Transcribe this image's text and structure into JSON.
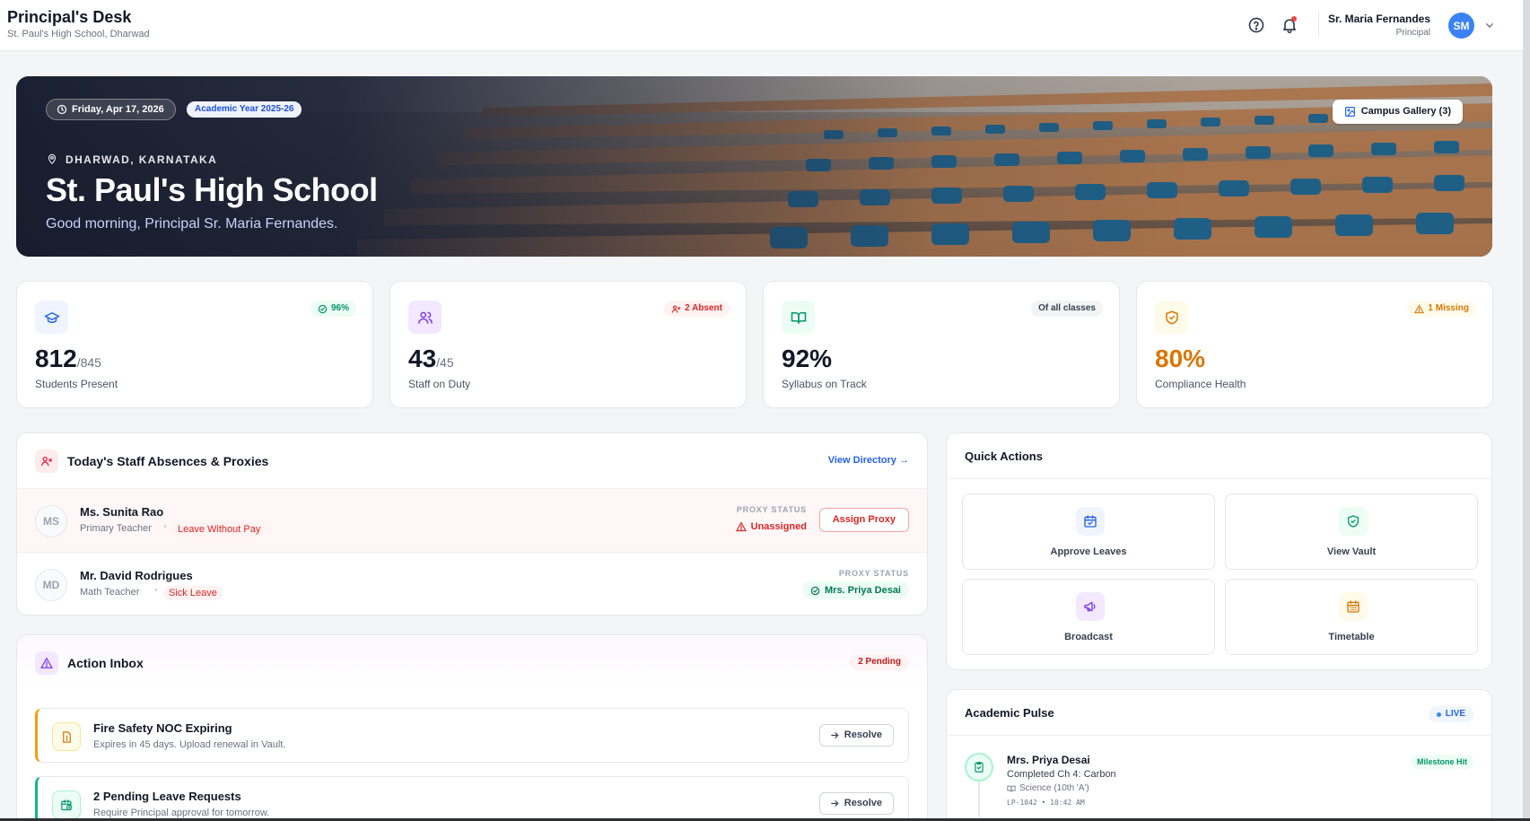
{
  "topbar": {
    "title": "Principal's Desk",
    "subtitle": "St. Paul's High School, Dharwad",
    "help_icon": "help-circle-icon",
    "bell_icon": "bell-icon",
    "user_name": "Sr. Maria Fernandes",
    "user_role": "Principal",
    "avatar_initials": "SM",
    "avatar_color": "#3b82f6"
  },
  "hero": {
    "date": "Friday, Apr 17, 2026",
    "academic_year": "Academic Year 2025-26",
    "location": "DHARWAD, KARNATAKA",
    "school_name": "St. Paul's High School",
    "greeting": "Good morning, Principal Sr. Maria Fernandes.",
    "gallery_button": "Campus Gallery (3)"
  },
  "kpis": [
    {
      "value": "812",
      "total": "/845",
      "label": "Students Present",
      "badge": "96%",
      "icon": "graduation-cap-icon",
      "accent": "#2563eb"
    },
    {
      "value": "43",
      "total": "/45",
      "label": "Staff on Duty",
      "badge": "2 Absent",
      "icon": "users-icon",
      "accent": "#7c3aed"
    },
    {
      "value": "92%",
      "total": "",
      "label": "Syllabus on Track",
      "badge": "Of all classes",
      "icon": "book-open-icon",
      "accent": "#059669"
    },
    {
      "value": "80%",
      "total": "",
      "label": "Compliance Health",
      "badge": "1 Missing",
      "icon": "shield-check-icon",
      "accent": "#d97706"
    }
  ],
  "absences": {
    "title": "Today's Staff Absences & Proxies",
    "view_directory": "View Directory",
    "rows": [
      {
        "initials": "MS",
        "name": "Ms. Sunita Rao",
        "role": "Primary Teacher",
        "leave": "Leave Without Pay",
        "proxy_label": "PROXY STATUS",
        "proxy_status": "Unassigned",
        "action": "Assign Proxy"
      },
      {
        "initials": "MD",
        "name": "Mr. David Rodrigues",
        "role": "Math Teacher",
        "leave": "Sick Leave",
        "proxy_label": "PROXY STATUS",
        "proxy_status": "Mrs. Priya Desai"
      }
    ]
  },
  "inbox": {
    "title": "Action Inbox",
    "pending": "2 Pending",
    "items": [
      {
        "title": "Fire Safety NOC Expiring",
        "desc": "Expires in 45 days. Upload renewal in Vault.",
        "action": "Resolve",
        "accent": "#f59e0b"
      },
      {
        "title": "2 Pending Leave Requests",
        "desc": "Require Principal approval for tomorrow.",
        "action": "Resolve",
        "accent": "#10b981"
      }
    ]
  },
  "quick_actions": {
    "title": "Quick Actions",
    "items": [
      {
        "label": "Approve Leaves",
        "icon": "calendar-check-icon",
        "accent": "#2563eb"
      },
      {
        "label": "View Vault",
        "icon": "shield-check-icon",
        "accent": "#059669"
      },
      {
        "label": "Broadcast",
        "icon": "megaphone-icon",
        "accent": "#7c3aed"
      },
      {
        "label": "Timetable",
        "icon": "calendar-grid-icon",
        "accent": "#d97706"
      }
    ]
  },
  "pulse": {
    "title": "Academic Pulse",
    "live": "LIVE",
    "entry": {
      "name": "Mrs. Priya Desai",
      "desc": "Completed Ch 4: Carbon",
      "subject": "Science (10th 'A')",
      "meta": "LP-1042 • 10:42 AM",
      "badge": "Milestone Hit"
    }
  }
}
